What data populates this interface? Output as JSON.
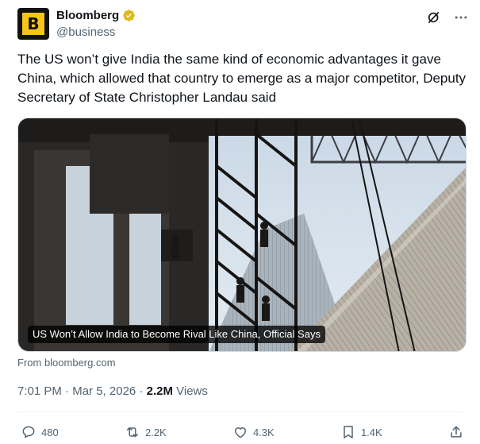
{
  "author": {
    "name": "Bloomberg",
    "handle": "@business",
    "avatar_letter": "B"
  },
  "tweet": {
    "text": "The US won’t give India the same kind of economic advantages it gave China, which allowed that country to emerge as a major competitor, Deputy Secretary of State Christopher Landau said"
  },
  "media": {
    "caption": "US Won’t Allow India to Become Rival Like China, Official Says",
    "source": "From bloomberg.com"
  },
  "meta": {
    "time": "7:01 PM",
    "date": "Mar 5, 2026",
    "views_count": "2.2M",
    "views_label": "Views"
  },
  "actions": {
    "replies": "480",
    "reposts": "2.2K",
    "likes": "4.3K",
    "bookmarks": "1.4K"
  },
  "icons": {
    "verified": "verified-badge-icon",
    "grok": "grok-icon",
    "more": "more-icon",
    "reply": "reply-icon",
    "repost": "repost-icon",
    "like": "heart-icon",
    "bookmark": "bookmark-icon",
    "share": "share-icon"
  },
  "colors": {
    "verified_gold": "#e2b719",
    "text_primary": "#0f1419",
    "text_secondary": "#536471",
    "brand_yellow": "#f5c518"
  }
}
